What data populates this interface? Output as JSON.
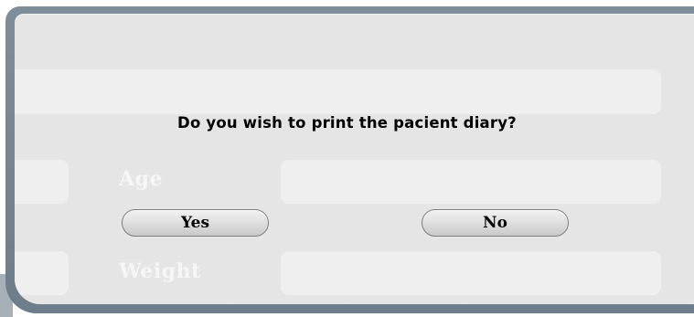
{
  "dialog": {
    "message": "Do you wish to print the pacient diary?",
    "yes_label": "Yes",
    "no_label": "No"
  },
  "background_form": {
    "age_label": "Age",
    "weight_label": "Weight"
  },
  "colors": {
    "frame": "#6d7d89",
    "panel": "#e5e5e5",
    "button_fill": "#e1e1e1",
    "button_border": "#7c7c7c",
    "ghost_field": "#efefef"
  }
}
